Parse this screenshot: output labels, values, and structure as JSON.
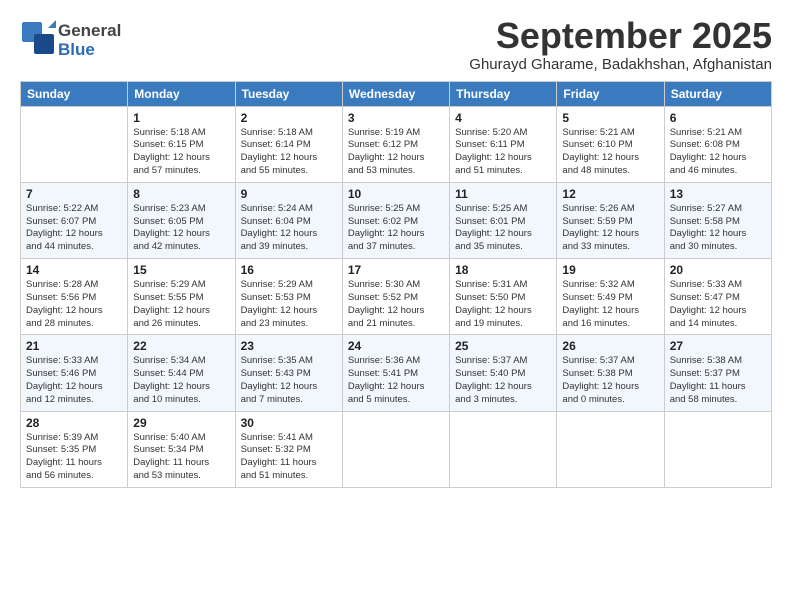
{
  "logo": {
    "general": "General",
    "blue": "Blue"
  },
  "title": "September 2025",
  "subtitle": "Ghurayd Gharame, Badakhshan, Afghanistan",
  "headers": [
    "Sunday",
    "Monday",
    "Tuesday",
    "Wednesday",
    "Thursday",
    "Friday",
    "Saturday"
  ],
  "weeks": [
    [
      {
        "day": "",
        "info": ""
      },
      {
        "day": "1",
        "info": "Sunrise: 5:18 AM\nSunset: 6:15 PM\nDaylight: 12 hours\nand 57 minutes."
      },
      {
        "day": "2",
        "info": "Sunrise: 5:18 AM\nSunset: 6:14 PM\nDaylight: 12 hours\nand 55 minutes."
      },
      {
        "day": "3",
        "info": "Sunrise: 5:19 AM\nSunset: 6:12 PM\nDaylight: 12 hours\nand 53 minutes."
      },
      {
        "day": "4",
        "info": "Sunrise: 5:20 AM\nSunset: 6:11 PM\nDaylight: 12 hours\nand 51 minutes."
      },
      {
        "day": "5",
        "info": "Sunrise: 5:21 AM\nSunset: 6:10 PM\nDaylight: 12 hours\nand 48 minutes."
      },
      {
        "day": "6",
        "info": "Sunrise: 5:21 AM\nSunset: 6:08 PM\nDaylight: 12 hours\nand 46 minutes."
      }
    ],
    [
      {
        "day": "7",
        "info": "Sunrise: 5:22 AM\nSunset: 6:07 PM\nDaylight: 12 hours\nand 44 minutes."
      },
      {
        "day": "8",
        "info": "Sunrise: 5:23 AM\nSunset: 6:05 PM\nDaylight: 12 hours\nand 42 minutes."
      },
      {
        "day": "9",
        "info": "Sunrise: 5:24 AM\nSunset: 6:04 PM\nDaylight: 12 hours\nand 39 minutes."
      },
      {
        "day": "10",
        "info": "Sunrise: 5:25 AM\nSunset: 6:02 PM\nDaylight: 12 hours\nand 37 minutes."
      },
      {
        "day": "11",
        "info": "Sunrise: 5:25 AM\nSunset: 6:01 PM\nDaylight: 12 hours\nand 35 minutes."
      },
      {
        "day": "12",
        "info": "Sunrise: 5:26 AM\nSunset: 5:59 PM\nDaylight: 12 hours\nand 33 minutes."
      },
      {
        "day": "13",
        "info": "Sunrise: 5:27 AM\nSunset: 5:58 PM\nDaylight: 12 hours\nand 30 minutes."
      }
    ],
    [
      {
        "day": "14",
        "info": "Sunrise: 5:28 AM\nSunset: 5:56 PM\nDaylight: 12 hours\nand 28 minutes."
      },
      {
        "day": "15",
        "info": "Sunrise: 5:29 AM\nSunset: 5:55 PM\nDaylight: 12 hours\nand 26 minutes."
      },
      {
        "day": "16",
        "info": "Sunrise: 5:29 AM\nSunset: 5:53 PM\nDaylight: 12 hours\nand 23 minutes."
      },
      {
        "day": "17",
        "info": "Sunrise: 5:30 AM\nSunset: 5:52 PM\nDaylight: 12 hours\nand 21 minutes."
      },
      {
        "day": "18",
        "info": "Sunrise: 5:31 AM\nSunset: 5:50 PM\nDaylight: 12 hours\nand 19 minutes."
      },
      {
        "day": "19",
        "info": "Sunrise: 5:32 AM\nSunset: 5:49 PM\nDaylight: 12 hours\nand 16 minutes."
      },
      {
        "day": "20",
        "info": "Sunrise: 5:33 AM\nSunset: 5:47 PM\nDaylight: 12 hours\nand 14 minutes."
      }
    ],
    [
      {
        "day": "21",
        "info": "Sunrise: 5:33 AM\nSunset: 5:46 PM\nDaylight: 12 hours\nand 12 minutes."
      },
      {
        "day": "22",
        "info": "Sunrise: 5:34 AM\nSunset: 5:44 PM\nDaylight: 12 hours\nand 10 minutes."
      },
      {
        "day": "23",
        "info": "Sunrise: 5:35 AM\nSunset: 5:43 PM\nDaylight: 12 hours\nand 7 minutes."
      },
      {
        "day": "24",
        "info": "Sunrise: 5:36 AM\nSunset: 5:41 PM\nDaylight: 12 hours\nand 5 minutes."
      },
      {
        "day": "25",
        "info": "Sunrise: 5:37 AM\nSunset: 5:40 PM\nDaylight: 12 hours\nand 3 minutes."
      },
      {
        "day": "26",
        "info": "Sunrise: 5:37 AM\nSunset: 5:38 PM\nDaylight: 12 hours\nand 0 minutes."
      },
      {
        "day": "27",
        "info": "Sunrise: 5:38 AM\nSunset: 5:37 PM\nDaylight: 11 hours\nand 58 minutes."
      }
    ],
    [
      {
        "day": "28",
        "info": "Sunrise: 5:39 AM\nSunset: 5:35 PM\nDaylight: 11 hours\nand 56 minutes."
      },
      {
        "day": "29",
        "info": "Sunrise: 5:40 AM\nSunset: 5:34 PM\nDaylight: 11 hours\nand 53 minutes."
      },
      {
        "day": "30",
        "info": "Sunrise: 5:41 AM\nSunset: 5:32 PM\nDaylight: 11 hours\nand 51 minutes."
      },
      {
        "day": "",
        "info": ""
      },
      {
        "day": "",
        "info": ""
      },
      {
        "day": "",
        "info": ""
      },
      {
        "day": "",
        "info": ""
      }
    ]
  ]
}
